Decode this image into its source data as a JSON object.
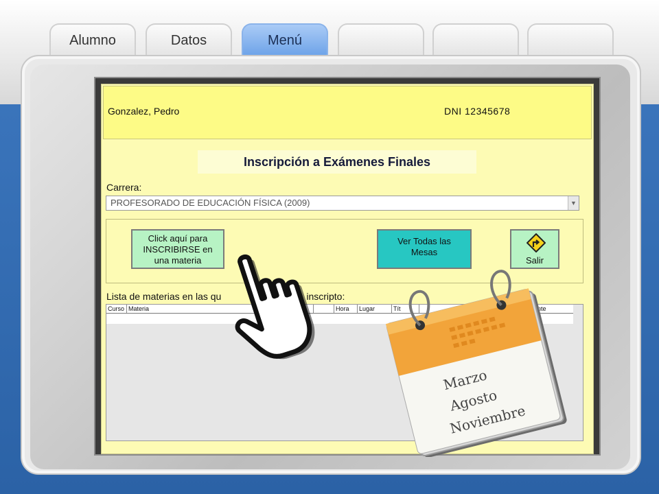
{
  "tabs": [
    {
      "label": "Alumno",
      "active": false
    },
    {
      "label": "Datos",
      "active": false
    },
    {
      "label": "Menú",
      "active": true
    },
    {
      "label": "",
      "active": false
    },
    {
      "label": "",
      "active": false
    },
    {
      "label": "",
      "active": false
    }
  ],
  "student": {
    "name": "Gonzalez, Pedro",
    "dni": "DNI  12345678"
  },
  "form": {
    "title": "Inscripción a Exámenes Finales",
    "carrera_label": "Carrera:",
    "carrera_value": "PROFESORADO DE EDUCACIÓN FÍSICA (2009)",
    "btn_inscribir": "Click aquí para\nINSCRIBIRSE en\nuna materia",
    "btn_mesas": "Ver Todas las\nMesas",
    "btn_salir": "Salir",
    "lista_part1": "Lista de materias en las qu",
    "lista_part2": "inscripto:",
    "columns": [
      "Curso",
      "Materia",
      "",
      "Hora",
      "Lugar",
      "Tít",
      "",
      "nte"
    ]
  },
  "calendar": {
    "months": [
      "Marzo",
      "Agosto",
      "Noviembre"
    ]
  },
  "colors": {
    "accent_tab": "#6ca2e8",
    "form_bg": "#fdfbb4",
    "btn_green": "#b7f3c4",
    "btn_teal": "#27c7c2",
    "calendar_orange": "#f2a43a"
  },
  "icons": {
    "pointer": "hand-pointer-icon",
    "exit": "road-sign-icon",
    "calendar": "calendar-icon"
  }
}
